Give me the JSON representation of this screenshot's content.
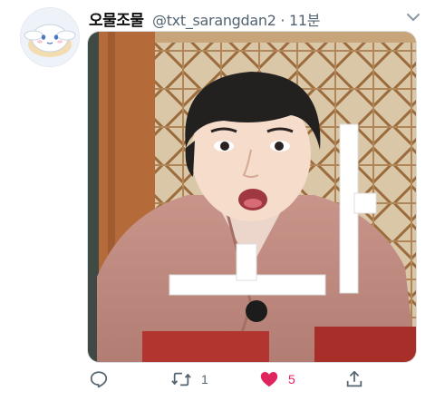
{
  "tweet": {
    "display_name": "오물조물",
    "handle_time": "@txt_sarangdan2 · 11분",
    "media_overlay_glyph": "ㅗㅏ"
  },
  "actions": {
    "reply": {
      "icon": "reply-icon",
      "count": ""
    },
    "retweet": {
      "icon": "retweet-icon",
      "count": "1"
    },
    "like": {
      "icon": "heart-icon",
      "count": "5",
      "liked": true,
      "color": "#e0245e"
    },
    "share": {
      "icon": "share-icon",
      "count": ""
    }
  },
  "colors": {
    "secondary_text": "#536471",
    "like_red": "#e0245e"
  }
}
